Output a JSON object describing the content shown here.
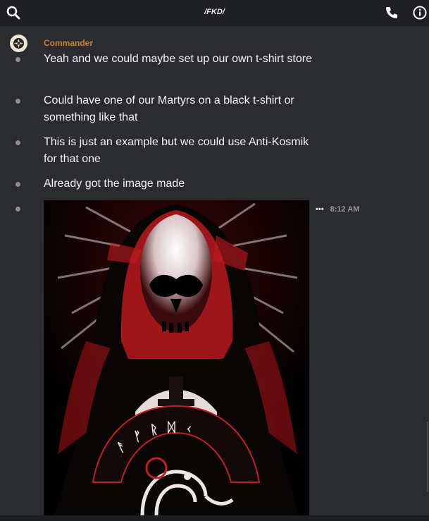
{
  "header": {
    "title": "/FKD/",
    "icons": [
      "search-icon",
      "phone-icon",
      "info-icon"
    ]
  },
  "message_group": {
    "author": "Commander",
    "author_color": "#c9832f",
    "messages": [
      {
        "text": "Yeah and we could maybe set up our own t-shirt store"
      },
      {
        "text": "Could have one of our Martyrs on a black t-shirt or something like that"
      },
      {
        "text": "This is just an example but we could use Anti-Kosmik for that one"
      },
      {
        "text": "Already got the image made"
      }
    ],
    "image_message": {
      "time": "8:12 AM",
      "more_label": "•••"
    }
  },
  "colors": {
    "background": "#2b2c30",
    "topbar": "#1e1f22",
    "image_red": "#b01218"
  }
}
